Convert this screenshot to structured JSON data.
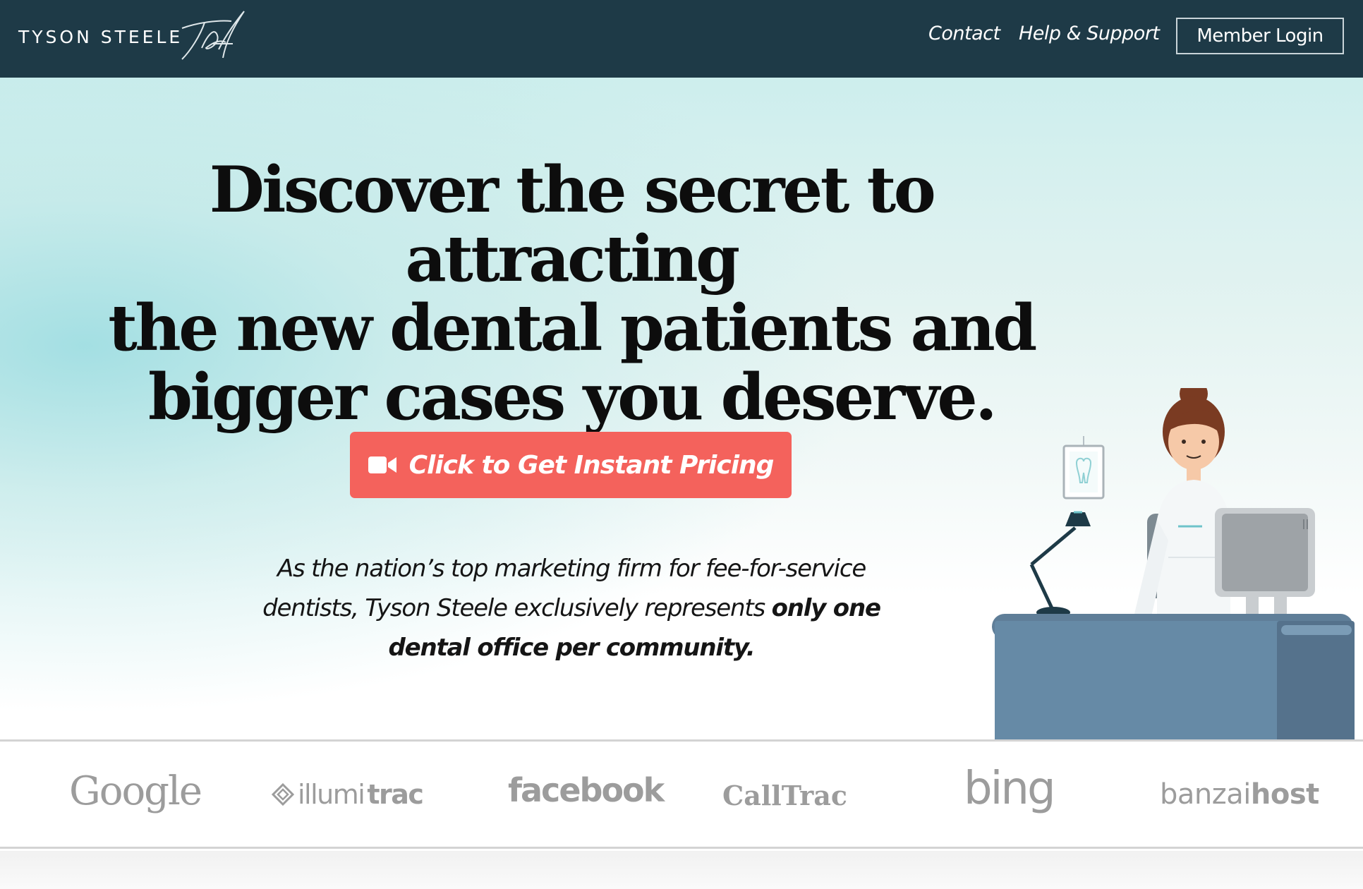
{
  "header": {
    "brand": "TYSON STEELE",
    "nav": {
      "contact": "Contact",
      "help": "Help & Support",
      "login": "Member Login"
    },
    "background_color": "#1e3a47"
  },
  "hero": {
    "headline_line1": "Discover the secret to attracting",
    "headline_line2": "the new dental patients and",
    "headline_line3_pre": "bigger cases ",
    "headline_line3_bold": "you deserve",
    "headline_line3_post": ".",
    "cta_label": "Click to Get Instant Pricing",
    "cta_color": "#f4625c",
    "cta_icon": "video-camera-icon",
    "subcopy_line1": "As the nation’s top marketing firm for fee-for-service",
    "subcopy_line2": "dentists, Tyson Steele exclusively represents ",
    "subcopy_bold1": "only one",
    "subcopy_bold2": "dental office per community."
  },
  "partners": [
    {
      "name": "Google"
    },
    {
      "prefix": "illumi",
      "suffix": "trac"
    },
    {
      "name": "facebook"
    },
    {
      "name": "CallTrac"
    },
    {
      "name": "bing"
    },
    {
      "prefix": "banzai",
      "suffix": "host"
    }
  ]
}
